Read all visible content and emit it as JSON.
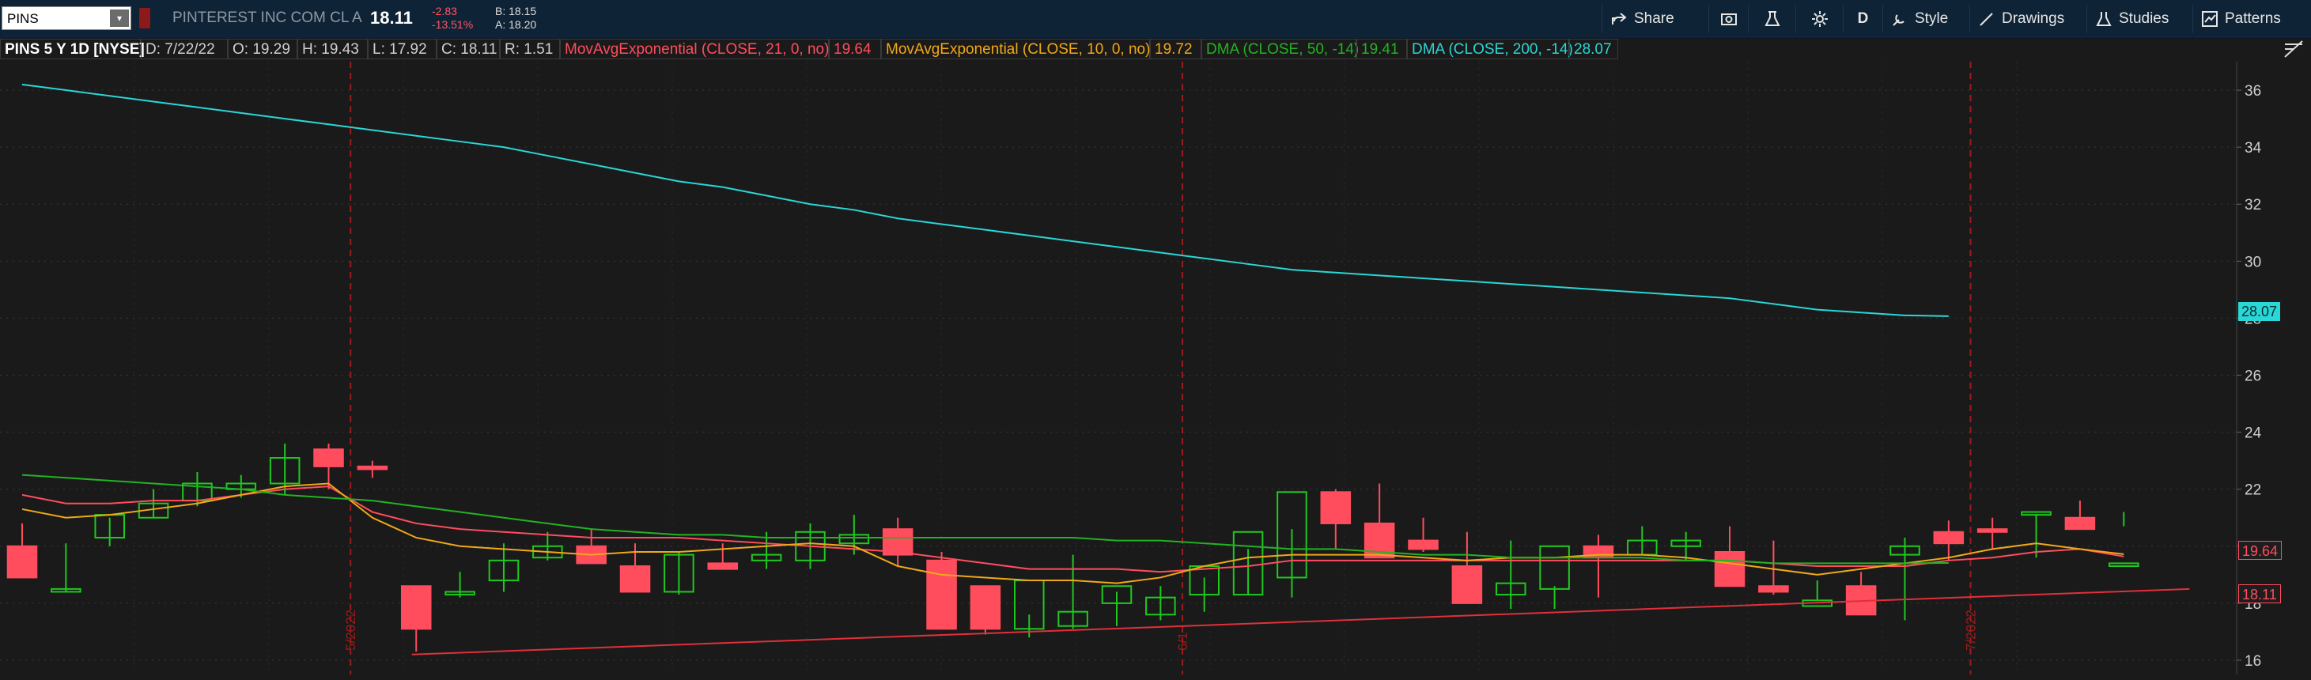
{
  "toolbar": {
    "symbol": "PINS",
    "company": "PINTEREST INC COM CL A",
    "last": "18.11",
    "change": "-2.83",
    "change_pct": "-13.51%",
    "bid": "B: 18.15",
    "ask": "A: 18.20",
    "share_label": "Share",
    "period_label": "D",
    "style_label": "Style",
    "drawings_label": "Drawings",
    "studies_label": "Studies",
    "patterns_label": "Patterns"
  },
  "legend": {
    "title": "PINS 5 Y 1D [NYSE]",
    "date": "D: 7/22/22",
    "open": "O: 19.29",
    "high": "H: 19.43",
    "low": "L: 17.92",
    "close": "C: 18.11",
    "range": "R: 1.51",
    "ema21_label": "MovAvgExponential (CLOSE, 21, 0, no)",
    "ema21_value": "19.64",
    "ema10_label": "MovAvgExponential (CLOSE, 10, 0, no)",
    "ema10_value": "19.72",
    "dma50_label": "DMA (CLOSE, 50, -14)",
    "dma50_value": "19.41",
    "dma200_label": "DMA (CLOSE, 200, -14)",
    "dma200_value": "28.07"
  },
  "colors": {
    "up": "#1fc91f",
    "down": "#ff4d5e",
    "ema21": "#ff4d5e",
    "ema10": "#f0a818",
    "dma50": "#22b322",
    "dma200": "#2ad6d6",
    "trendline": "#e0303a",
    "period_marker": "#9a1c1c"
  },
  "chart_data": {
    "type": "candlestick",
    "title": "PINS 5 Y 1D [NYSE]",
    "ylim": [
      15.5,
      37
    ],
    "yticks": [
      16,
      18,
      20,
      22,
      24,
      26,
      28,
      30,
      32,
      34,
      36
    ],
    "y_tick_labels": [
      "16",
      "18",
      "20",
      "22",
      "24",
      "26",
      "28",
      "30",
      "32",
      "34",
      "36"
    ],
    "x": [
      1,
      2,
      3,
      4,
      5,
      6,
      7,
      8,
      9,
      10,
      11,
      12,
      13,
      14,
      15,
      16,
      17,
      18,
      19,
      20,
      21,
      22,
      23,
      24,
      25,
      26,
      27,
      28,
      29,
      30,
      31,
      32,
      33,
      34,
      35,
      36,
      37,
      38,
      39,
      40,
      41,
      42,
      43,
      44,
      45,
      46,
      47,
      48,
      49,
      50
    ],
    "period_markers": [
      {
        "x": 8.5,
        "label": "5/2022"
      },
      {
        "x": 27.5,
        "label": "6/1"
      },
      {
        "x": 45.5,
        "label": "7/2022"
      }
    ],
    "candles": {
      "open": [
        20.0,
        18.4,
        20.3,
        21.0,
        21.6,
        22.0,
        22.2,
        23.4,
        22.8,
        18.6,
        18.3,
        18.8,
        19.6,
        20.0,
        19.3,
        18.4,
        19.4,
        19.5,
        19.5,
        20.1,
        20.6,
        19.5,
        18.6,
        17.1,
        17.2,
        18.0,
        17.6,
        18.3,
        18.3,
        18.9,
        21.9,
        20.8,
        20.2,
        19.3,
        18.3,
        18.5,
        20.0,
        19.7,
        20.0,
        19.8,
        18.6,
        17.9,
        18.6,
        19.7,
        20.5,
        20.6,
        21.1,
        21.0,
        19.3
      ],
      "high": [
        20.8,
        20.1,
        21.0,
        22.0,
        22.6,
        22.5,
        23.6,
        23.6,
        23.0,
        18.6,
        19.1,
        20.1,
        20.5,
        20.6,
        20.1,
        19.8,
        20.1,
        20.5,
        20.8,
        21.1,
        21.0,
        19.8,
        18.6,
        17.6,
        19.7,
        18.4,
        18.6,
        18.9,
        19.9,
        20.6,
        22.0,
        22.2,
        21.0,
        20.5,
        20.2,
        18.6,
        20.4,
        20.7,
        20.5,
        20.7,
        20.2,
        18.8,
        19.1,
        20.3,
        20.9,
        21.0,
        21.1,
        21.6,
        21.2,
        19.4
      ],
      "low": [
        19.0,
        18.4,
        20.0,
        21.0,
        21.4,
        21.7,
        21.8,
        22.0,
        22.4,
        16.3,
        18.2,
        18.4,
        19.5,
        19.6,
        18.4,
        18.3,
        19.2,
        19.2,
        19.2,
        19.7,
        19.3,
        17.4,
        16.9,
        16.8,
        17.1,
        17.2,
        17.4,
        17.7,
        18.3,
        18.2,
        19.9,
        19.8,
        19.8,
        19.2,
        17.8,
        17.8,
        18.2,
        19.7,
        19.5,
        19.6,
        18.3,
        18.1,
        17.7,
        17.4,
        19.5,
        19.9,
        19.6,
        20.9,
        20.7,
        17.9
      ],
      "close": [
        18.9,
        18.5,
        21.1,
        21.5,
        22.2,
        22.2,
        23.1,
        22.8,
        22.7,
        17.1,
        18.4,
        19.5,
        20.0,
        19.4,
        18.4,
        19.7,
        19.2,
        19.7,
        20.5,
        20.4,
        19.7,
        17.1,
        17.1,
        18.8,
        17.7,
        18.6,
        18.2,
        19.3,
        20.5,
        21.9,
        20.8,
        19.6,
        19.9,
        18.0,
        18.7,
        20.0,
        19.6,
        20.2,
        20.2,
        18.6,
        18.4,
        18.1,
        17.6,
        20.0,
        20.1,
        20.5,
        21.2,
        20.6,
        19.4,
        18.11
      ]
    },
    "series": [
      {
        "name": "MovAvgExponential (CLOSE, 21, 0, no)",
        "values": [
          21.8,
          21.5,
          21.5,
          21.6,
          21.6,
          21.8,
          22.0,
          22.1,
          21.2,
          20.8,
          20.6,
          20.5,
          20.4,
          20.3,
          20.3,
          20.3,
          20.2,
          20.1,
          20.0,
          19.9,
          19.8,
          19.6,
          19.4,
          19.2,
          19.2,
          19.2,
          19.1,
          19.2,
          19.3,
          19.5,
          19.5,
          19.5,
          19.5,
          19.5,
          19.5,
          19.5,
          19.5,
          19.5,
          19.5,
          19.5,
          19.4,
          19.3,
          19.3,
          19.3,
          19.5,
          19.6,
          19.8,
          19.9,
          19.64
        ]
      },
      {
        "name": "MovAvgExponential (CLOSE, 10, 0, no)",
        "values": [
          21.3,
          21.0,
          21.1,
          21.3,
          21.5,
          21.8,
          22.1,
          22.2,
          21.0,
          20.3,
          20.0,
          19.9,
          19.8,
          19.7,
          19.8,
          19.8,
          19.9,
          20.0,
          20.1,
          20.0,
          19.3,
          19.0,
          18.9,
          18.8,
          18.8,
          18.7,
          18.9,
          19.3,
          19.6,
          19.7,
          19.7,
          19.7,
          19.6,
          19.5,
          19.6,
          19.6,
          19.7,
          19.7,
          19.6,
          19.4,
          19.2,
          19.0,
          19.2,
          19.4,
          19.6,
          19.9,
          20.1,
          19.9,
          19.72
        ]
      },
      {
        "name": "DMA (CLOSE, 50, -14)",
        "values": [
          22.5,
          22.4,
          22.3,
          22.2,
          22.1,
          22.0,
          21.8,
          21.7,
          21.6,
          21.4,
          21.2,
          21.0,
          20.8,
          20.6,
          20.5,
          20.4,
          20.4,
          20.3,
          20.3,
          20.3,
          20.3,
          20.3,
          20.3,
          20.3,
          20.3,
          20.2,
          20.2,
          20.1,
          20.0,
          19.9,
          19.9,
          19.8,
          19.7,
          19.7,
          19.6,
          19.6,
          19.6,
          19.6,
          19.5,
          19.5,
          19.4,
          19.4,
          19.4,
          19.4,
          19.41
        ]
      },
      {
        "name": "DMA (CLOSE, 200, -14)",
        "values": [
          36.2,
          36.0,
          35.8,
          35.6,
          35.4,
          35.2,
          35.0,
          34.8,
          34.6,
          34.4,
          34.2,
          34.0,
          33.7,
          33.4,
          33.1,
          32.8,
          32.6,
          32.3,
          32.0,
          31.8,
          31.5,
          31.3,
          31.1,
          30.9,
          30.7,
          30.5,
          30.3,
          30.1,
          29.9,
          29.7,
          29.6,
          29.5,
          29.4,
          29.3,
          29.2,
          29.1,
          29.0,
          28.9,
          28.8,
          28.7,
          28.5,
          28.3,
          28.2,
          28.1,
          28.07
        ]
      },
      {
        "name": "trendline",
        "points": [
          [
            9.9,
            16.2
          ],
          [
            50.5,
            18.5
          ]
        ]
      }
    ]
  }
}
